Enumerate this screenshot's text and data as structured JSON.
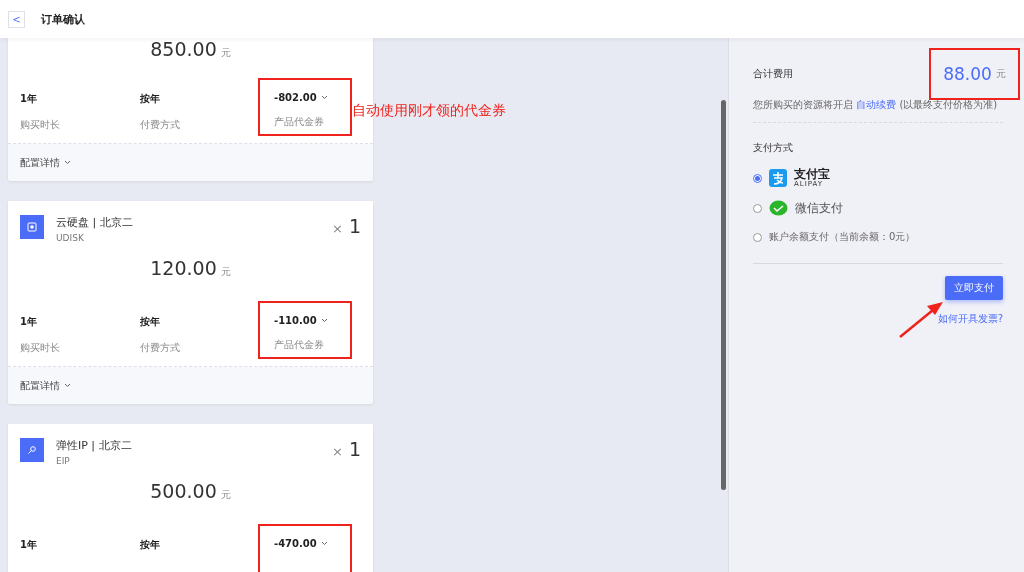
{
  "header": {
    "back": "<",
    "title": "订单确认"
  },
  "annotation": {
    "text": "自动使用刚才领的代金券"
  },
  "items": [
    {
      "price": "850.00",
      "unit": "元",
      "duration": "1年",
      "duration_label": "购买时长",
      "billing": "按年",
      "billing_label": "付费方式",
      "voucher": "-802.00",
      "voucher_label": "产品代金券",
      "annotated": true,
      "details": "配置详情"
    },
    {
      "kind": "disk",
      "name": "云硬盘 | 北京二",
      "code": "UDISK",
      "quantity_mark": "×",
      "quantity": "1",
      "price": "120.00",
      "unit": "元",
      "duration": "1年",
      "duration_label": "购买时长",
      "billing": "按年",
      "billing_label": "付费方式",
      "voucher": "-110.00",
      "voucher_label": "产品代金券",
      "annotated": true,
      "details": "配置详情"
    },
    {
      "kind": "ip",
      "name": "弹性IP | 北京二",
      "code": "EIP",
      "quantity_mark": "×",
      "quantity": "1",
      "price": "500.00",
      "unit": "元",
      "duration": "1年",
      "billing": "按年",
      "voucher": "-470.00",
      "annotated": true
    }
  ],
  "summary": {
    "total_label": "合计费用",
    "total": "88.00",
    "unit": "元",
    "total_annotated": true,
    "note_before": "您所购买的资源将开启",
    "note_link": "自动续费",
    "note_after": "(以最终支付价格为准)",
    "payment_label": "支付方式",
    "payment_methods": [
      {
        "kind": "alipay",
        "label": "支付宝",
        "sublabel": "ALIPAY",
        "selected": true
      },
      {
        "kind": "wechat",
        "label": "微信支付",
        "selected": false
      },
      {
        "kind": "balance",
        "label": "账户余额支付（当前余额：0元）",
        "selected": false
      }
    ],
    "pay_button": "立即支付",
    "invoice_link": "如何开具发票?",
    "arrow": true
  }
}
